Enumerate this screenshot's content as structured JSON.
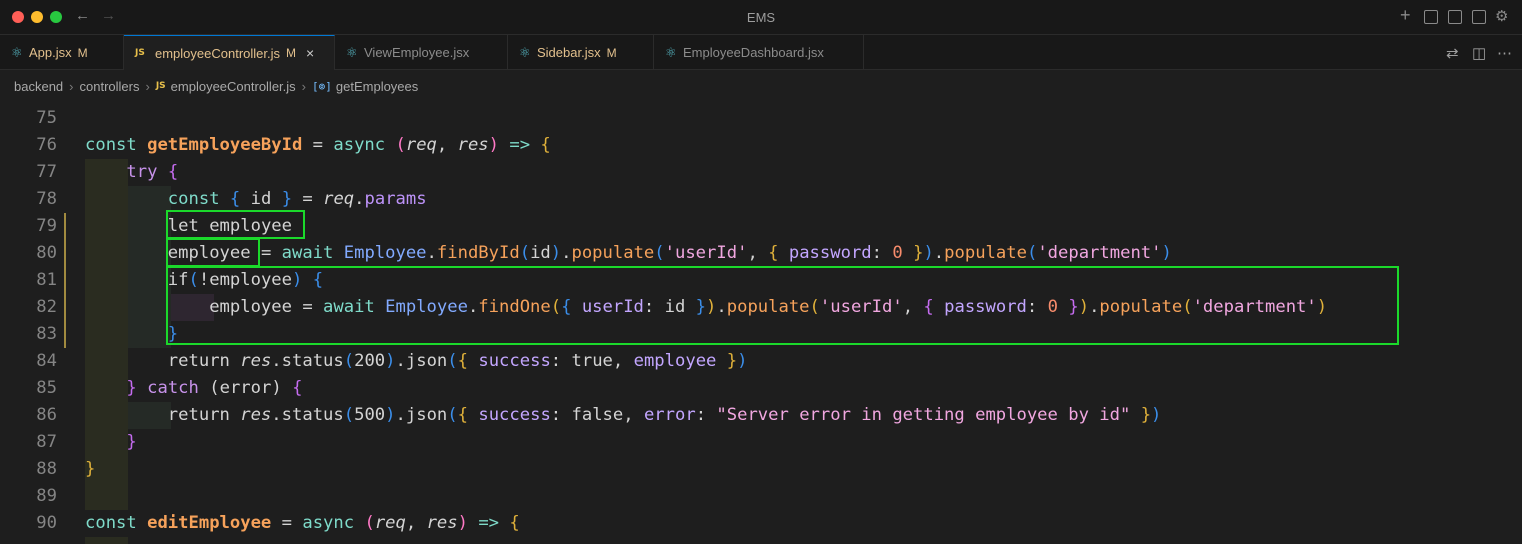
{
  "window": {
    "title": "EMS"
  },
  "tabs": [
    {
      "label": "App.jsx",
      "icon": "react-icon",
      "modified": "M",
      "active": false
    },
    {
      "label": "employeeController.js",
      "icon": "js-icon",
      "modified": "M",
      "active": true,
      "close": "×"
    },
    {
      "label": "ViewEmployee.jsx",
      "icon": "react-icon",
      "modified": "",
      "active": false
    },
    {
      "label": "Sidebar.jsx",
      "icon": "react-icon",
      "modified": "M",
      "active": false
    },
    {
      "label": "EmployeeDashboard.jsx",
      "icon": "react-icon",
      "modified": "",
      "active": false
    }
  ],
  "breadcrumb": {
    "folder1": "backend",
    "folder2": "controllers",
    "file_badge": "JS",
    "file": "employeeController.js",
    "symbol_icon": "[⊚]",
    "symbol": "getEmployees"
  },
  "icons": {
    "react": "⚛",
    "js": "JS",
    "back": "←",
    "forward": "→",
    "plus": "+",
    "gear": "⚙",
    "compare": "⇄",
    "split": "◫",
    "more": "⋯",
    "sep": "›"
  },
  "editor": {
    "line_numbers": [
      "75",
      "76",
      "77",
      "78",
      "79",
      "80",
      "81",
      "82",
      "83",
      "84",
      "85",
      "86",
      "87",
      "88",
      "89",
      "90"
    ],
    "tokens": {
      "const": "const",
      "getEmployeeById": "getEmployeeById",
      "editEmployee": "editEmployee",
      "eq": " = ",
      "async": "async",
      "req": "req",
      "res": "res",
      "arrow": "=>",
      "try": "try",
      "id": "id",
      "params": "params",
      "let": "let",
      "employee": "employee",
      "await": "await",
      "Employee": "Employee",
      "findById": "findById",
      "findOne": "findOne",
      "populate": "populate",
      "userId_str": "'userId'",
      "department_str": "'department'",
      "password": "password",
      "zero": "0",
      "userId": "userId",
      "if": "if",
      "return": "return",
      "status": "status",
      "json": "json",
      "n200": "200",
      "n500": "500",
      "success": "success",
      "true": "true",
      "false": "false",
      "catch": "catch",
      "error": "error",
      "err_msg": "\"Server error in getting employee by id\""
    }
  }
}
